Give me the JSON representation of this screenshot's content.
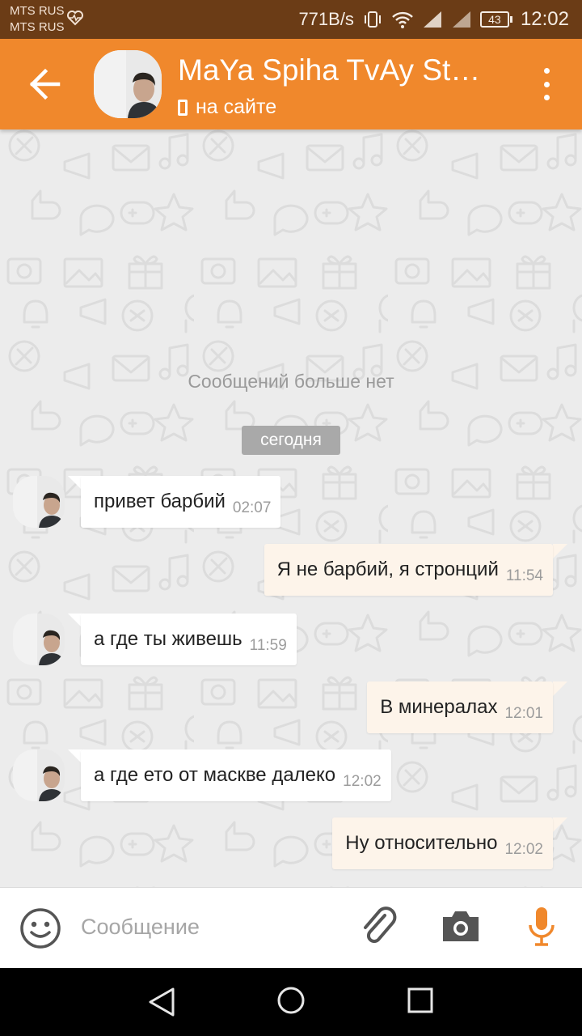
{
  "status_bar": {
    "carrier1": "MTS RUS",
    "carrier2": "MTS RUS",
    "net_speed": "771B/s",
    "battery": "43",
    "time": "12:02"
  },
  "header": {
    "title": "MaYa Spiha TvAy St…",
    "status": "на сайте",
    "accent_color": "#f0882c"
  },
  "chat": {
    "no_more": "Сообщений больше нет",
    "date_chip": "сегодня",
    "messages": [
      {
        "dir": "in",
        "text": "привет барбий",
        "time": "02:07"
      },
      {
        "dir": "out",
        "text": "Я не барбий, я стронций",
        "time": "11:54"
      },
      {
        "dir": "in",
        "text": "а где ты живешь",
        "time": "11:59"
      },
      {
        "dir": "out",
        "text": "В минералах",
        "time": "12:01"
      },
      {
        "dir": "in",
        "text": "а где ето от маскве далеко",
        "time": "12:02"
      },
      {
        "dir": "out",
        "text": "Ну относительно",
        "time": "12:02"
      }
    ]
  },
  "input": {
    "placeholder": "Сообщение",
    "mic_color": "#f0882c"
  },
  "icons": {
    "back": "arrow-left-icon",
    "menu": "more-vertical-icon",
    "emoji": "smile-icon",
    "attach": "paperclip-icon",
    "camera": "camera-icon",
    "mic": "microphone-icon"
  }
}
